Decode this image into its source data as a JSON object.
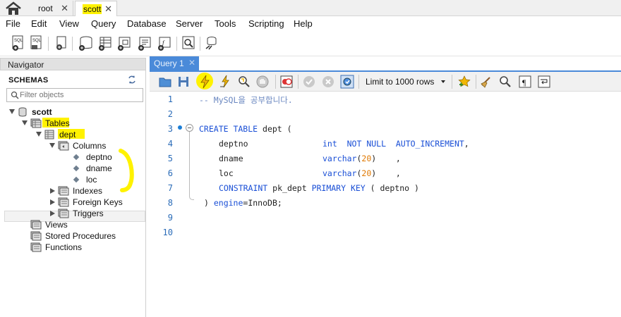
{
  "connection_tabs": [
    {
      "label": "root"
    },
    {
      "label": "scott",
      "active": true
    }
  ],
  "menu": [
    "File",
    "Edit",
    "View",
    "Query",
    "Database",
    "Server",
    "Tools",
    "Scripting",
    "Help"
  ],
  "navigator": {
    "header": "Navigator",
    "section_title": "SCHEMAS",
    "filter_placeholder": "Filter objects",
    "tree": {
      "schema": "scott",
      "tables_label": "Tables",
      "table": "dept",
      "columns_label": "Columns",
      "columns": [
        "deptno",
        "dname",
        "loc"
      ],
      "table_children": [
        "Indexes",
        "Foreign Keys",
        "Triggers"
      ],
      "schema_children": [
        "Views",
        "Stored Procedures",
        "Functions"
      ]
    }
  },
  "query_tab": {
    "label": "Query 1"
  },
  "query_toolbar": {
    "limit_label": "Limit to 1000 rows"
  },
  "editor": {
    "line_numbers": [
      "1",
      "2",
      "3",
      "4",
      "5",
      "6",
      "7",
      "8",
      "9",
      "10"
    ],
    "lines": {
      "l1": "-- MySQL을 공부합니다.",
      "l3_kw": "CREATE TABLE",
      "l3_rest": " dept (",
      "l4_col": "deptno",
      "l4_type": "int",
      "l4_rest": "  NOT NULL  AUTO_INCREMENT",
      "l4_end": ",",
      "l5_col": "dname",
      "l5_type": "varchar",
      "l5_num": "20",
      "l6_col": "loc",
      "l6_type": "varchar",
      "l6_num": "20",
      "l7_kw1": "CONSTRAINT",
      "l7_mid": " pk_dept ",
      "l7_kw2": "PRIMARY KEY",
      "l7_rest": " ( deptno )",
      "l8_a": ") ",
      "l8_kw": "engine",
      "l8_b": "=InnoDB;"
    }
  },
  "colors": {
    "accent": "#4a8ad9",
    "highlight": "#fff200",
    "keyword": "#1a4fd6",
    "number": "#e07800"
  }
}
